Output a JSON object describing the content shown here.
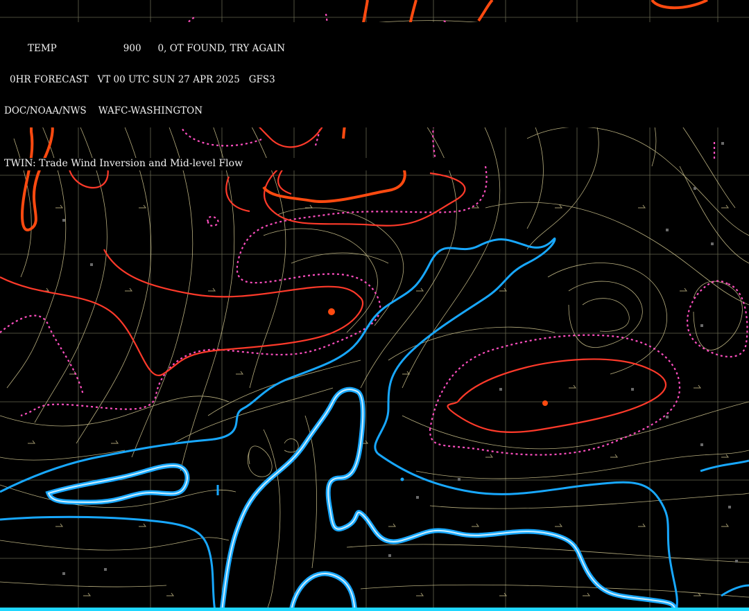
{
  "header": {
    "line1_left": "TEMP",
    "line1_mid": "900",
    "line1_right": "0, OT FOUND, TRY AGAIN",
    "line2": "0HR FORECAST   VT 00 UTC SUN 27 APR 2025   GFS3",
    "line3": "DOC/NOAA/NWS    WAFC-WASHINGTON"
  },
  "product": {
    "title": "TWIN: Trade Wind Inversion and Mid-level Flow"
  },
  "colors": {
    "background": "#000000",
    "grid": "#8a8a6a",
    "streamline": "#e8dca0",
    "temp_warm_solid": "#ff3a2a",
    "temp_warm_thick": "#ff4a10",
    "temp_dashed": "#ff4fc0",
    "moisture": "#18a8ff",
    "moisture_core": "#cdefff",
    "bottom_strip": "#1fd7ff"
  }
}
